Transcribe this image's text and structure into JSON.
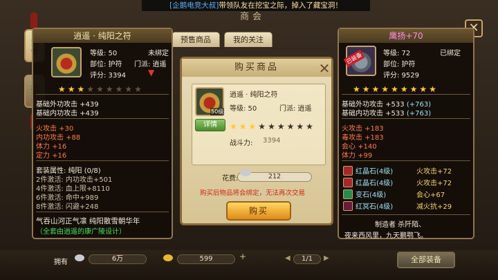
{
  "banner": {
    "channel": "[企鹅电竞大叔]",
    "message": "带领队友在挖宝之际，掉入了藏宝洞！"
  },
  "shop": {
    "title": "商会",
    "side_tabs": [
      "商会",
      "拍卖"
    ],
    "tabs": [
      "预售商品",
      "我的关注"
    ]
  },
  "left_item": {
    "name": "逍遥 · 纯阳之符",
    "level_label": "等级: 50",
    "bind": "未绑定",
    "part": "部位: 护符",
    "school": "门派: 逍遥",
    "score": "评分: 3394",
    "stars_on": 3,
    "stars_total": 9,
    "base": [
      "基础外功攻击 +439",
      "基础内功攻击 +439"
    ],
    "attrs": [
      "火攻击 +30",
      "内功攻击 +88",
      "体力 +16",
      "定力 +16"
    ],
    "set_title": "套装属性: 纯阳 (0/8)",
    "set_rows": [
      "2件激活: 内功攻击+501",
      "4件激活: 血上限+8110",
      "6件激活: 命中+989",
      "8件激活: 闪避+248"
    ],
    "flavor": "气吞山河正气凛 纯阳散雪朝华年",
    "designer": "（全套由逍遥的康广陵设计）"
  },
  "right_item": {
    "name": "鹰扬+70",
    "level_label": "等级: 72",
    "bind": "已绑定",
    "part": "部位: 护符",
    "score": "评分: 9529",
    "badge": "已装备",
    "stars_on": 9,
    "stars_total": 9,
    "base": [
      [
        "基础外功攻击 +533",
        "(+763)"
      ],
      [
        "基础内功攻击 +533",
        "(+763)"
      ]
    ],
    "attrs": [
      "火攻击 +183",
      "毒攻击 +183",
      "会心 +140",
      "体力 +99"
    ],
    "gems": [
      {
        "name": "红晶石",
        "lvl": "(4级)",
        "stat": "火攻击+72"
      },
      {
        "name": "红晶石",
        "lvl": "(4级)",
        "stat": "火攻击+72"
      },
      {
        "name": "变石",
        "lvl": "(4级)",
        "stat": "会心+67"
      },
      {
        "name": "红冥石",
        "lvl": "(4级)",
        "stat": "减火抗+29"
      }
    ],
    "maker": "制造者 杀阡陌、",
    "flavor": "夜来西风里，九天鹏鹗飞。"
  },
  "dialog": {
    "title": "购买商品",
    "item_name": "逍遥 · 纯阳之符",
    "level_label": "等级: 50",
    "school": "门派: 逍遥",
    "icon_level": "50级",
    "detail": "详情",
    "stars_on": 3,
    "stars_total": 9,
    "power_label": "战斗力:",
    "power": "3394",
    "cost_label": "花费:",
    "cost": "212",
    "warning": "购买后物品将会绑定，无法再次交易",
    "buy": "购买"
  },
  "bottom": {
    "own_label": "拥有",
    "silver": "6万",
    "gold": "599",
    "page": "1/1",
    "all_equip": "全部装备"
  }
}
